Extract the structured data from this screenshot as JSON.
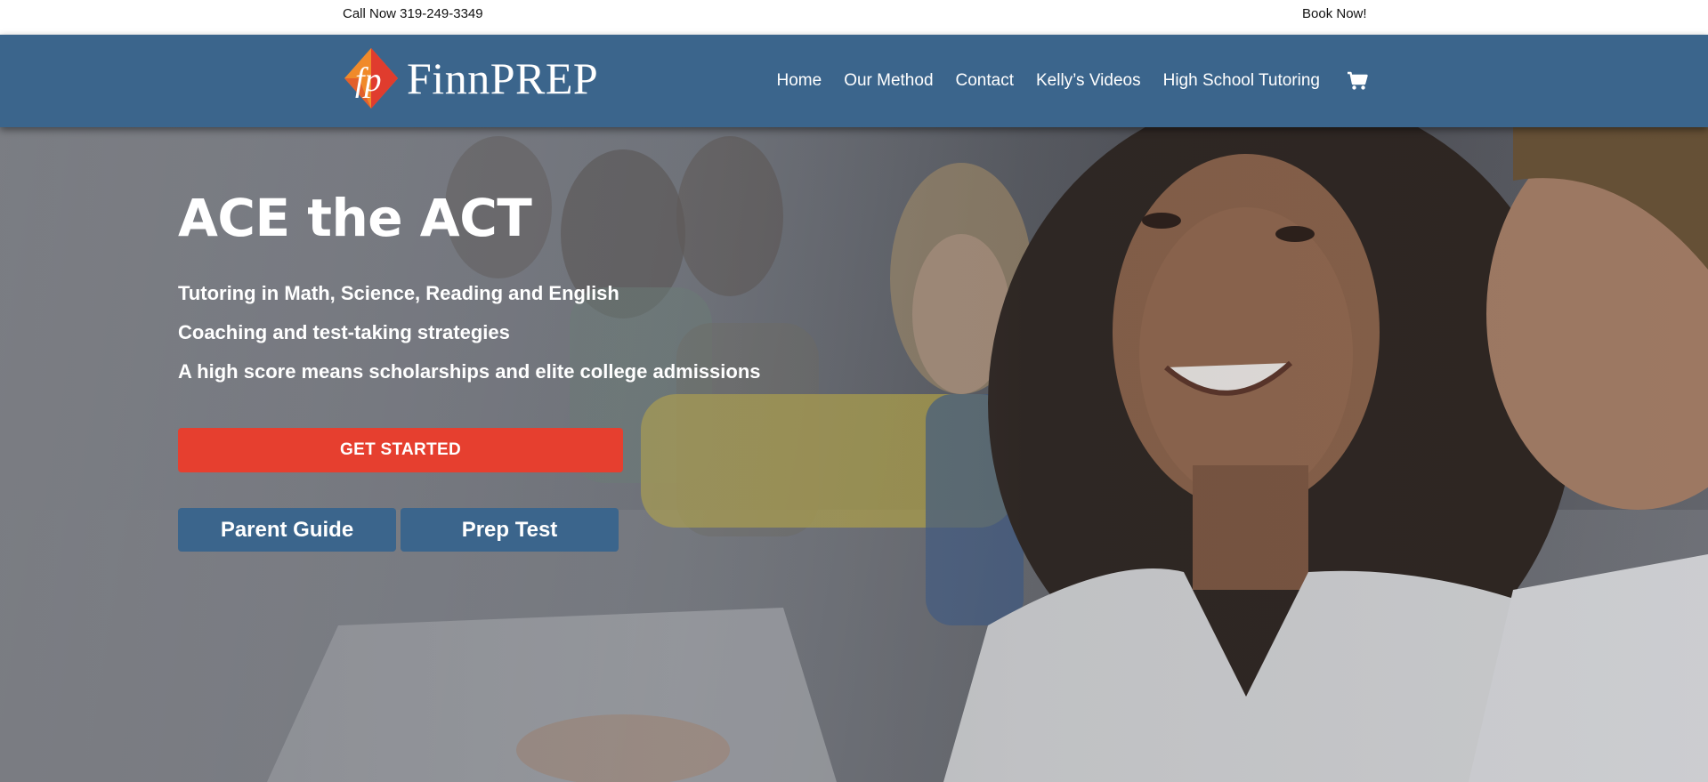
{
  "topbar": {
    "phone_text": "Call Now 319-249-3349",
    "book_link": "Book Now!"
  },
  "header": {
    "brand_name": "FinnPREP",
    "logo_mark": "fp",
    "colors": {
      "header_bg": "#3b658c",
      "logo_orange": "#f08a2a",
      "logo_red": "#e03c2e"
    },
    "nav": [
      {
        "label": "Home"
      },
      {
        "label": "Our Method"
      },
      {
        "label": "Contact"
      },
      {
        "label": "Kelly’s Videos"
      },
      {
        "label": "High School Tutoring"
      }
    ],
    "cart_icon": "shopping-cart-icon"
  },
  "hero": {
    "title": "ACE the ACT",
    "lines": [
      "Tutoring in Math, Science, Reading and English",
      "Coaching and test-taking strategies",
      "A high score means scholarships and elite college admissions"
    ],
    "cta_label": "GET STARTED",
    "buttons": [
      {
        "label": "Parent Guide"
      },
      {
        "label": "Prep Test"
      }
    ],
    "colors": {
      "cta": "#e63f2f",
      "secondary": "#3b658c"
    }
  }
}
